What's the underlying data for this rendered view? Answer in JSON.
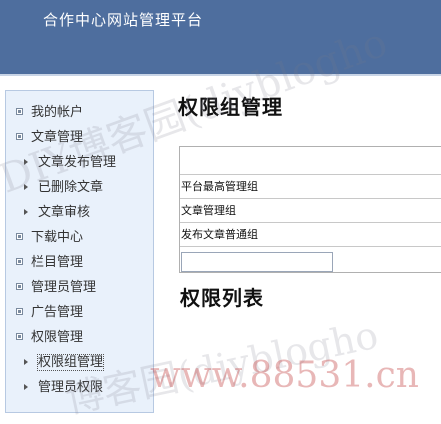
{
  "header": {
    "title": "合作中心网站管理平台"
  },
  "sidebar": {
    "items": [
      {
        "label": "我的帐户",
        "kind": "top"
      },
      {
        "label": "文章管理",
        "kind": "top"
      },
      {
        "label": "文章发布管理",
        "kind": "sub"
      },
      {
        "label": "已删除文章",
        "kind": "sub"
      },
      {
        "label": "文章审核",
        "kind": "sub"
      },
      {
        "label": "下载中心",
        "kind": "top"
      },
      {
        "label": "栏目管理",
        "kind": "top"
      },
      {
        "label": "管理员管理",
        "kind": "top"
      },
      {
        "label": "广告管理",
        "kind": "top"
      },
      {
        "label": "权限管理",
        "kind": "top"
      },
      {
        "label": "权限组管理",
        "kind": "sub",
        "active": true
      },
      {
        "label": "管理员权限",
        "kind": "sub"
      }
    ]
  },
  "main": {
    "title": "权限组管理",
    "groups": [
      "平台最高管理组",
      "文章管理组",
      "发布文章普通组"
    ],
    "new_group_value": "",
    "list_title": "权限列表"
  },
  "watermark": {
    "text1": "DIY博客园(diyblogho",
    "text2": "博客园(diyblogho",
    "text3": "www.88531.cn"
  }
}
